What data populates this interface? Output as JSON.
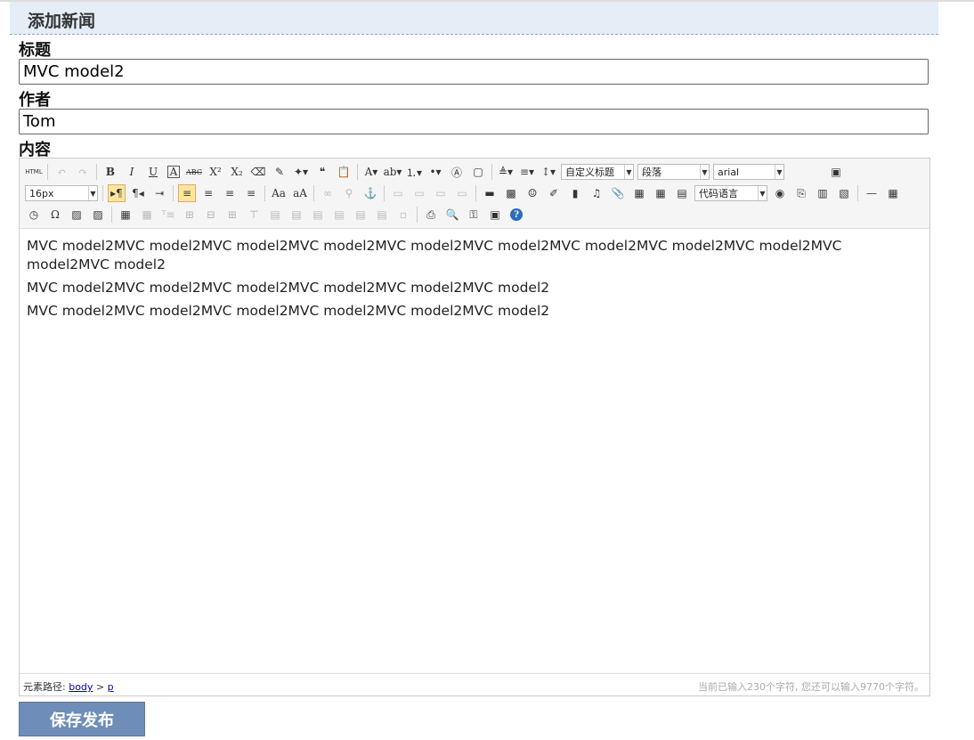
{
  "header": {
    "title": "添加新闻"
  },
  "form": {
    "title_label": "标题",
    "title_value": "MVC model2",
    "author_label": "作者",
    "author_value": "Tom",
    "content_label": "内容"
  },
  "toolbar": {
    "row1": [
      {
        "name": "source-html-icon",
        "glyph": "HTML"
      },
      {
        "sep": true
      },
      {
        "name": "undo-icon",
        "glyph": "↶",
        "dim": true
      },
      {
        "name": "redo-icon",
        "glyph": "↷",
        "dim": true
      },
      {
        "sep": true
      },
      {
        "name": "bold-icon",
        "glyph": "B"
      },
      {
        "name": "italic-icon",
        "glyph": "I"
      },
      {
        "name": "underline-icon",
        "glyph": "U"
      },
      {
        "name": "font-border-icon",
        "glyph": "A"
      },
      {
        "name": "strikethrough-icon",
        "glyph": "ABC"
      },
      {
        "name": "superscript-icon",
        "glyph": "X²"
      },
      {
        "name": "subscript-icon",
        "glyph": "X₂"
      },
      {
        "name": "remove-format-icon",
        "glyph": "⌫"
      },
      {
        "name": "format-match-icon",
        "glyph": "✎"
      },
      {
        "name": "auto-typeset-icon",
        "glyph": "✦▾"
      },
      {
        "name": "blockquote-icon",
        "glyph": "❝"
      },
      {
        "name": "paste-plain-icon",
        "glyph": "📋"
      },
      {
        "sep": true
      },
      {
        "name": "forecolor-icon",
        "glyph": "A▾"
      },
      {
        "name": "backcolor-icon",
        "glyph": "ab▾"
      },
      {
        "name": "ordered-list-icon",
        "glyph": "⒈▾"
      },
      {
        "name": "unordered-list-icon",
        "glyph": "•▾"
      },
      {
        "name": "select-all-icon",
        "glyph": "Ⓐ"
      },
      {
        "name": "clear-doc-icon",
        "glyph": "▢"
      },
      {
        "sep": true
      },
      {
        "name": "row-spacing-top-icon",
        "glyph": "≜▾"
      },
      {
        "name": "row-spacing-bottom-icon",
        "glyph": "≡▾"
      },
      {
        "name": "line-height-icon",
        "glyph": "↕▾"
      },
      {
        "combo": "custom-heading-select",
        "label": "自定义标题",
        "w": 82
      },
      {
        "combo": "paragraph-select",
        "label": "段落",
        "w": 81
      },
      {
        "combo": "font-family-select",
        "label": "arial",
        "w": 80
      },
      {
        "spacer": 44
      },
      {
        "name": "fullscreen-icon",
        "glyph": "▣"
      }
    ],
    "row2": [
      {
        "combo": "font-size-select",
        "label": "16px",
        "w": 82
      },
      {
        "sep": true
      },
      {
        "name": "direction-ltr-icon",
        "glyph": "▸¶",
        "on": true
      },
      {
        "name": "direction-rtl-icon",
        "glyph": "¶◂"
      },
      {
        "name": "indent-icon",
        "glyph": "⇥"
      },
      {
        "sep": true
      },
      {
        "name": "align-left-icon",
        "glyph": "≡",
        "on": true
      },
      {
        "name": "align-center-icon",
        "glyph": "≡"
      },
      {
        "name": "align-right-icon",
        "glyph": "≡"
      },
      {
        "name": "align-justify-icon",
        "glyph": "≡"
      },
      {
        "sep": true
      },
      {
        "name": "to-uppercase-icon",
        "glyph": "Aa"
      },
      {
        "name": "to-lowercase-icon",
        "glyph": "aA"
      },
      {
        "sep": true
      },
      {
        "name": "link-icon",
        "glyph": "∞",
        "dim": true
      },
      {
        "name": "unlink-icon",
        "glyph": "⚲",
        "dim": true
      },
      {
        "name": "anchor-icon",
        "glyph": "⚓"
      },
      {
        "sep": true
      },
      {
        "name": "image-none-icon",
        "glyph": "▭",
        "dim": true
      },
      {
        "name": "image-left-icon",
        "glyph": "▭",
        "dim": true
      },
      {
        "name": "image-right-icon",
        "glyph": "▭",
        "dim": true
      },
      {
        "name": "image-center-icon",
        "glyph": "▭",
        "dim": true
      },
      {
        "sep": true
      },
      {
        "name": "simple-upload-icon",
        "glyph": "▬"
      },
      {
        "name": "insert-image-icon",
        "glyph": "▩"
      },
      {
        "name": "emotion-icon",
        "glyph": "☺"
      },
      {
        "name": "scrawl-icon",
        "glyph": "✐"
      },
      {
        "name": "insert-video-icon",
        "glyph": "▮"
      },
      {
        "name": "music-icon",
        "glyph": "♫"
      },
      {
        "name": "attachment-icon",
        "glyph": "📎"
      },
      {
        "name": "map-icon",
        "glyph": "▦"
      },
      {
        "name": "gmap-icon",
        "glyph": "▦"
      },
      {
        "name": "insert-frame-icon",
        "glyph": "▤"
      },
      {
        "combo": "code-language-select",
        "label": "代码语言",
        "w": 82
      },
      {
        "name": "webapp-icon",
        "glyph": "◉"
      },
      {
        "name": "page-break-icon",
        "glyph": "⎘"
      },
      {
        "name": "template-icon",
        "glyph": "▥"
      },
      {
        "name": "background-icon",
        "glyph": "▧"
      },
      {
        "sep": true
      },
      {
        "name": "horizontal-rule-icon",
        "glyph": "—"
      },
      {
        "name": "date-icon",
        "glyph": "▦"
      }
    ],
    "row3": [
      {
        "name": "time-icon",
        "glyph": "◷"
      },
      {
        "name": "special-chars-icon",
        "glyph": "Ω"
      },
      {
        "name": "word-image-icon",
        "glyph": "▨"
      },
      {
        "name": "snapscreen-icon",
        "glyph": "▨"
      },
      {
        "sep": true
      },
      {
        "name": "insert-table-icon",
        "glyph": "▦"
      },
      {
        "name": "delete-table-icon",
        "glyph": "▦",
        "dim": true
      },
      {
        "name": "insert-paragraph-before-table-icon",
        "glyph": "ᵀ≡",
        "dim": true
      },
      {
        "name": "insert-row-icon",
        "glyph": "⊞",
        "dim": true
      },
      {
        "name": "delete-row-icon",
        "glyph": "⊟",
        "dim": true
      },
      {
        "name": "insert-col-icon",
        "glyph": "⊞",
        "dim": true
      },
      {
        "name": "delete-col-icon",
        "glyph": "⊤",
        "dim": true
      },
      {
        "name": "merge-cells-icon",
        "glyph": "▤",
        "dim": true
      },
      {
        "name": "merge-right-icon",
        "glyph": "▤",
        "dim": true
      },
      {
        "name": "merge-down-icon",
        "glyph": "▤",
        "dim": true
      },
      {
        "name": "split-to-cells-icon",
        "glyph": "▤",
        "dim": true
      },
      {
        "name": "split-to-rows-icon",
        "glyph": "▤",
        "dim": true
      },
      {
        "name": "split-to-cols-icon",
        "glyph": "▤",
        "dim": true
      },
      {
        "name": "chart-icon",
        "glyph": "▫",
        "dim": true
      },
      {
        "sep": true
      },
      {
        "name": "print-icon",
        "glyph": "⎙"
      },
      {
        "name": "preview-icon",
        "glyph": "🔍"
      },
      {
        "name": "search-replace-icon",
        "glyph": "⚿"
      },
      {
        "name": "drafts-icon",
        "glyph": "▣"
      },
      {
        "name": "help-icon",
        "glyph": "?",
        "blue": true
      }
    ]
  },
  "content": {
    "paragraphs": [
      "MVC model2MVC model2MVC model2MVC model2MVC model2MVC model2MVC model2MVC model2MVC model2MVC model2MVC model2",
      "MVC model2MVC model2MVC model2MVC model2MVC model2MVC model2",
      "MVC model2MVC model2MVC model2MVC model2MVC model2MVC model2"
    ]
  },
  "statusbar": {
    "path_label": "元素路径:",
    "path_body": "body",
    "path_sep": ">",
    "path_p": "p",
    "count_text": "当前已输入230个字符, 您还可以输入9770个字符。"
  },
  "save_button": {
    "label": "保存发布"
  }
}
